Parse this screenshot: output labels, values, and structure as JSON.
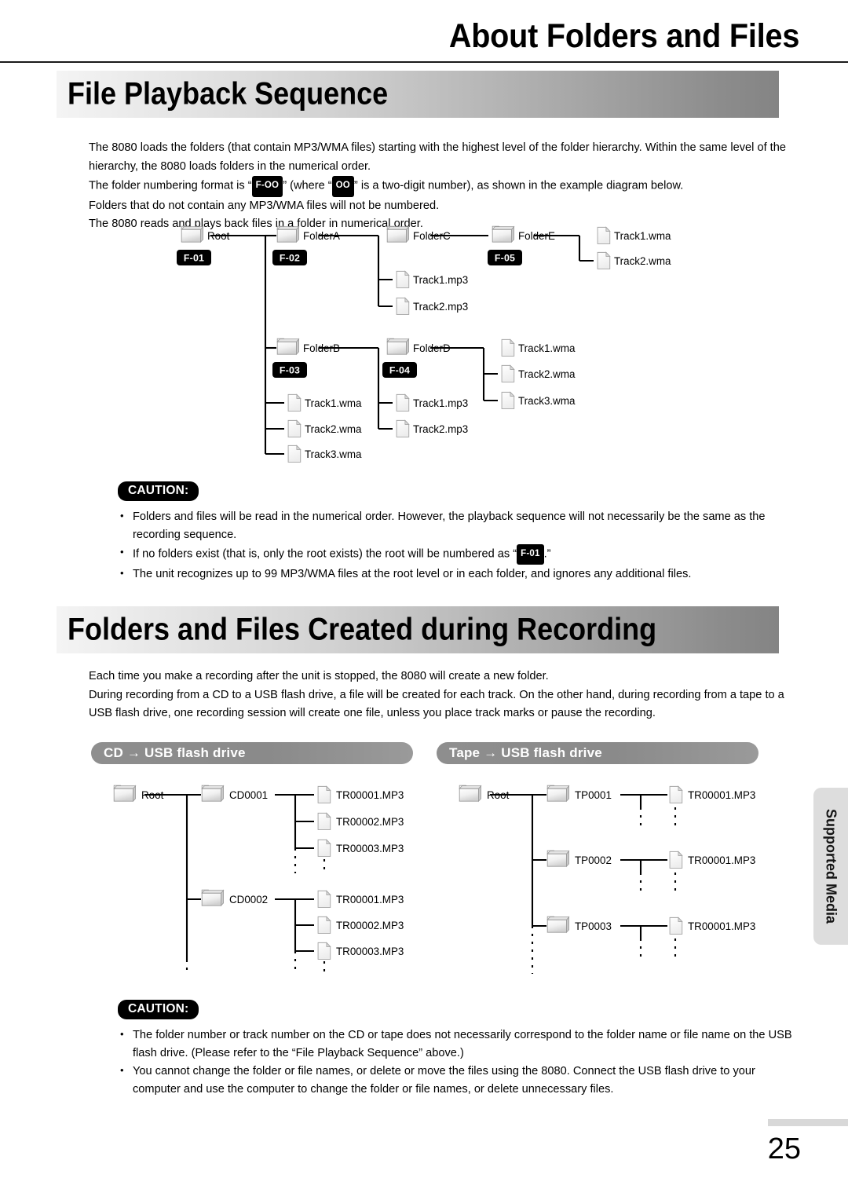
{
  "header": {
    "title": "About Folders and Files"
  },
  "sections": [
    {
      "banner_title": "File Playback Sequence",
      "paragraphs": [
        "The 8080 loads the folders (that contain MP3/WMA files) starting with the highest level of the folder hierarchy. Within the same level of the hierarchy, the 8080 loads folders in the numerical order.",
        "The folder numbering format is “",
        "” (where “",
        "” is a two-digit number), as shown in the example diagram below.",
        "Folders that do not contain any MP3/WMA files will not be numbered.",
        "The 8080 reads and plays back files in a folder in numerical order."
      ],
      "inline_badges": {
        "folder_format": "F-OO",
        "two_digit": "OO"
      }
    },
    {
      "banner_title": "Folders and Files Created during Recording",
      "paragraphs": [
        "Each time you make a recording after the unit is stopped, the 8080 will create a new folder.",
        "During recording from a CD to a USB flash drive, a file will be created for each track. On the other hand, during recording from a tape to a USB flash drive, one recording session will create one file, unless you place track marks or pause the recording."
      ]
    }
  ],
  "playback_tree": {
    "folders": [
      {
        "name": "Root",
        "badge": "F-01"
      },
      {
        "name": "FolderA",
        "badge": "F-02"
      },
      {
        "name": "FolderC",
        "badge": null
      },
      {
        "name": "FolderE",
        "badge": "F-05"
      },
      {
        "name": "FolderB",
        "badge": "F-03"
      },
      {
        "name": "FolderD",
        "badge": "F-04"
      }
    ],
    "folderE_files": [
      "Track1.wma",
      "Track2.wma"
    ],
    "folderC_files": [
      "Track1.mp3",
      "Track2.mp3"
    ],
    "folderD_files": [
      "Track1.wma",
      "Track2.wma",
      "Track3.wma"
    ],
    "folderB_files": [
      "Track1.wma",
      "Track2.wma"
    ],
    "root_files": [
      "Track1.wma",
      "Track2.wma",
      "Track3.wma"
    ],
    "folderD_sub_files": [
      "Track1.mp3",
      "Track2.mp3"
    ]
  },
  "caution_top": {
    "label": "CAUTION:",
    "items": [
      "Folders and files will be read in the numerical order. However, the playback sequence will not necessarily be the same as the recording sequence.",
      "If no folders exist (that is, only the root exists) the root will be numbered as “",
      "The unit recognizes up to 99 MP3/WMA files at the root level or in each folder, and ignores any additional files."
    ],
    "item2_badge": "F-01",
    "item2_tail": ".”"
  },
  "recording_diagrams": {
    "cd": {
      "pill_label": "CD → USB flash drive",
      "root": "Root",
      "folders": [
        {
          "name": "CD0001",
          "files": [
            "TR00001.MP3",
            "TR00002.MP3",
            "TR00003.MP3"
          ]
        },
        {
          "name": "CD0002",
          "files": [
            "TR00001.MP3",
            "TR00002.MP3",
            "TR00003.MP3"
          ]
        }
      ]
    },
    "tape": {
      "pill_label": "Tape → USB flash drive",
      "root": "Root",
      "folders": [
        {
          "name": "TP0001",
          "files": [
            "TR00001.MP3"
          ]
        },
        {
          "name": "TP0002",
          "files": [
            "TR00001.MP3"
          ]
        },
        {
          "name": "TP0003",
          "files": [
            "TR00001.MP3"
          ]
        }
      ]
    }
  },
  "caution_bottom": {
    "label": "CAUTION:",
    "items": [
      "The folder number or track number on the CD or tape does not necessarily correspond to the folder name or file name on the USB flash drive. (Please refer to the “File Playback Sequence” above.)",
      "You cannot change the folder or file names, or delete or move the files using the 8080. Connect the USB flash drive to your computer and use the computer to change the folder or file names, or delete unnecessary files."
    ]
  },
  "side_tab": {
    "label": "Supported Media"
  },
  "footer": {
    "page_number": "25"
  }
}
